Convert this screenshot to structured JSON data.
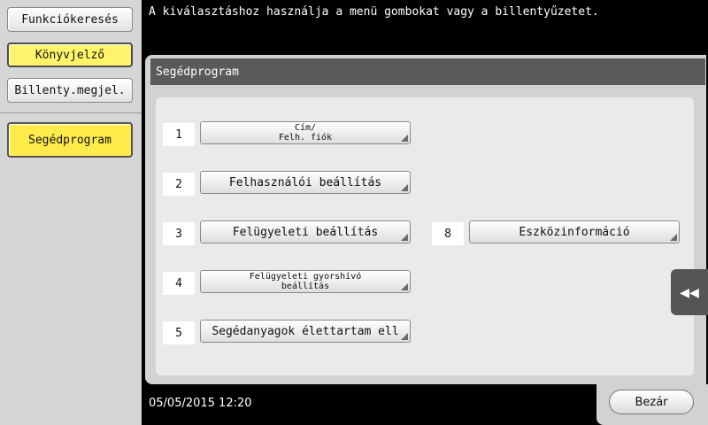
{
  "sidebar": {
    "items": [
      {
        "label": "Funkciókeresés"
      },
      {
        "label": "Könyvjelző"
      },
      {
        "label": "Billenty.megjel."
      },
      {
        "label": "Segédprogram"
      }
    ]
  },
  "message": "A kiválasztáshoz használja a menü gombokat vagy a billentyűzetet.",
  "panel": {
    "title": "Segédprogram",
    "items": [
      {
        "num": "1",
        "label": "Cím/\nFelh. fiók"
      },
      {
        "num": "2",
        "label": "Felhasználói beállítás"
      },
      {
        "num": "3",
        "label": "Felügyeleti beállítás"
      },
      {
        "num": "4",
        "label": "Felügyeleti gyorshívó\nbeállítás"
      },
      {
        "num": "5",
        "label": "Segédanyagok élettartam ell"
      },
      {
        "num": "8",
        "label": "Eszközinformáció"
      }
    ]
  },
  "back_icon": "double-chevron-left-icon",
  "footer": {
    "datetime": "05/05/2015   12:20",
    "close_label": "Bezár"
  }
}
